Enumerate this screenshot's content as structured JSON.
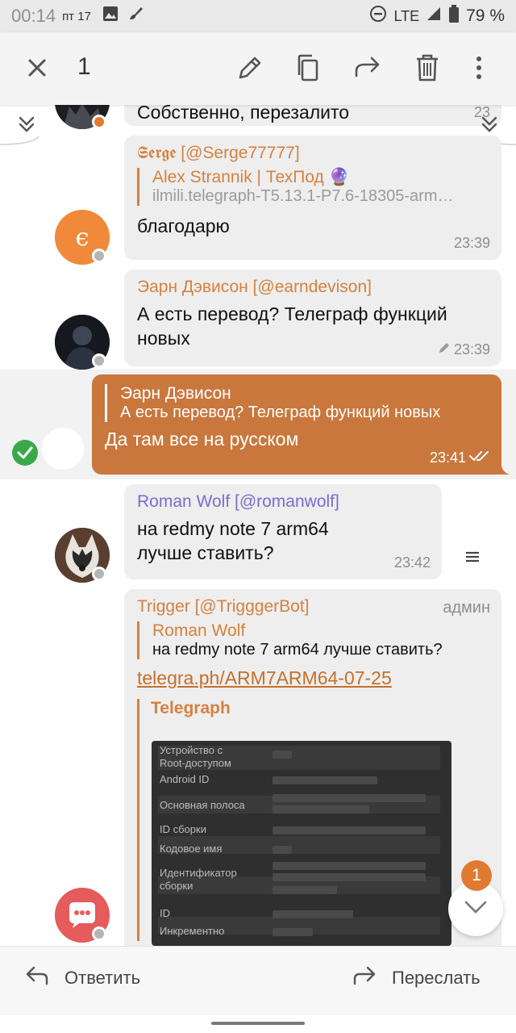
{
  "status_bar": {
    "time": "00:14",
    "date": "пт 17",
    "network": "LTE",
    "battery": "79 %"
  },
  "action_bar": {
    "selected_count": "1"
  },
  "messages": [
    {
      "partial_text": "Собственно, перезалито",
      "time": "23"
    },
    {
      "sender": "𝕾𝖊𝖗𝖌𝖊 [@Serge77777]",
      "reply_name": "Alex Strannik | ТехПод 🔮",
      "reply_text": "ilmili.telegraph-T5.13.1-P7.6-18305-arm…",
      "text": "благодарю",
      "time": "23:39"
    },
    {
      "sender": "Эарн Дэвисон [@earndevison]",
      "text": "А есть перевод? Телеграф функций новых",
      "time": "23:39"
    },
    {
      "reply_name": "Эарн Дэвисон",
      "reply_text": "А есть перевод? Телеграф функций новых",
      "text": "Да там все на русском",
      "time": "23:41"
    },
    {
      "sender": "Roman Wolf [@romanwolf]",
      "text": "на redmy note 7  arm64 лучше ставить?",
      "time": "23:42"
    },
    {
      "sender": "Trigger [@TrigggerBot]",
      "badge": "админ",
      "reply_name": "Roman Wolf",
      "reply_text": "на redmy note 7  arm64 лучше ставить?",
      "link": "telegra.ph/ARM7ARM64-07-25",
      "preview_site": "Telegraph",
      "preview_rows": [
        "Устройство с\nRoot-доступом",
        "Android ID",
        "Основная полоса",
        "ID сборки",
        "Кодовое имя",
        "Идентификатор\nсборки",
        "ID",
        "Инкрементно"
      ]
    }
  ],
  "unread_count": "1",
  "bottom_bar": {
    "reply_label": "Ответить",
    "forward_label": "Переслать"
  },
  "colors": {
    "accent": "#d5813e",
    "outgoing_bubble": "#c9773d",
    "roman_name": "#7f6ad0",
    "check_green": "#3aa84a"
  }
}
